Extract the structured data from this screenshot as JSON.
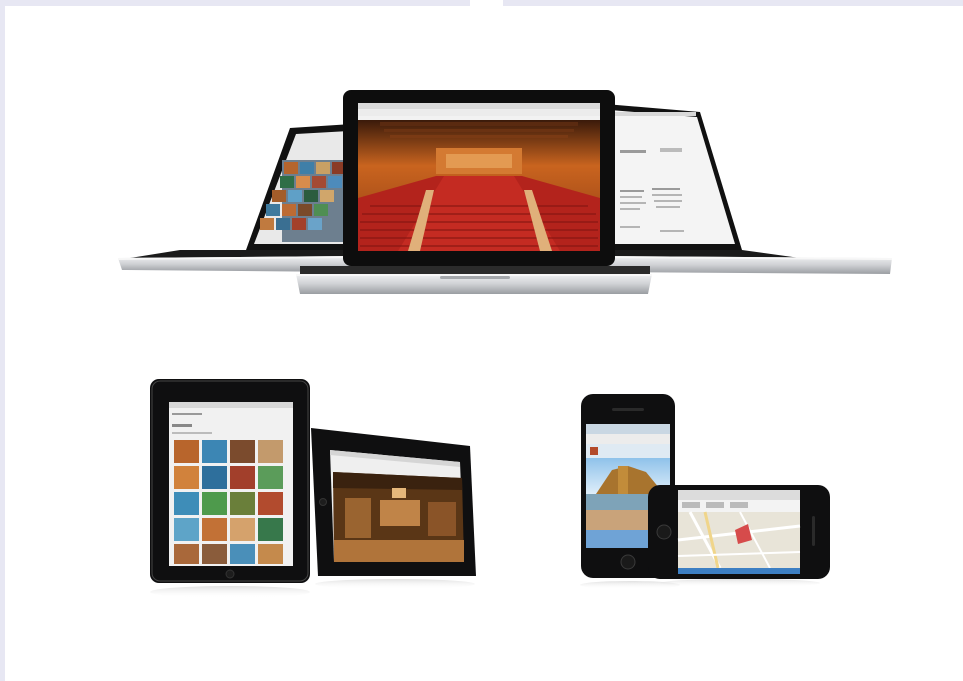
{
  "scene": {
    "background": "#ffffff",
    "frame_color": "#e7e7f3",
    "devices": [
      {
        "id": "laptop-left",
        "kind": "laptop",
        "screen_content": "photo-gallery"
      },
      {
        "id": "laptop-center",
        "kind": "laptop",
        "screen_content": "concert-hall"
      },
      {
        "id": "laptop-right",
        "kind": "laptop",
        "screen_content": "text-page"
      },
      {
        "id": "tablet-portrait",
        "kind": "tablet",
        "screen_content": "photo-grid"
      },
      {
        "id": "tablet-landscape",
        "kind": "tablet",
        "screen_content": "interior-photo"
      },
      {
        "id": "phone-portrait",
        "kind": "phone",
        "screen_content": "building-photo"
      },
      {
        "id": "phone-landscape",
        "kind": "phone",
        "screen_content": "map"
      }
    ],
    "colors": {
      "device_black": "#0f0f10",
      "aluminium": "#cfd1d4",
      "hall_orange": "#c9641f",
      "seat_red": "#b3231c",
      "map_bg": "#e8e4d8",
      "sky_blue": "#7fb6e0"
    }
  }
}
